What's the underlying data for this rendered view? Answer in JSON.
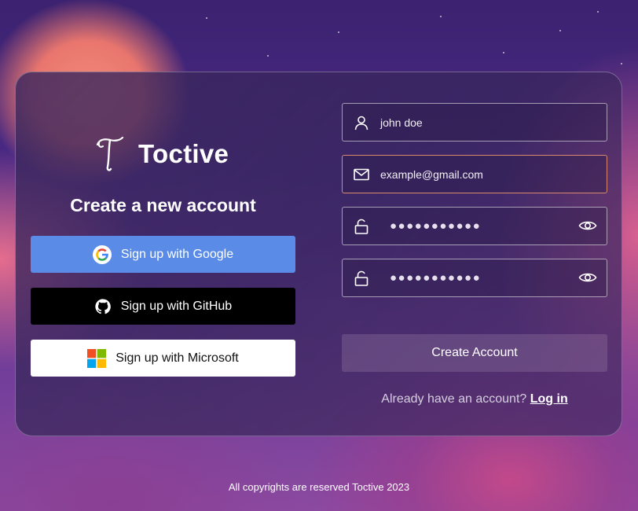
{
  "brand": {
    "name": "Toctive"
  },
  "heading": "Create a new account",
  "sso": {
    "google": "Sign up with Google",
    "github": "Sign up with GitHub",
    "microsoft": "Sign up with Microsoft"
  },
  "form": {
    "name_value": "john doe",
    "email_value": "example@gmail.com",
    "password_mask": "●●●●●●●●●●●",
    "confirm_mask": "●●●●●●●●●●●",
    "submit_label": "Create Account"
  },
  "login": {
    "prompt": "Already have an account?",
    "link": "Log in"
  },
  "footer": "All copyrights are reserved Toctive 2023",
  "colors": {
    "google_button": "#5a8be6",
    "github_button": "#000000",
    "microsoft_button": "#ffffff",
    "email_focus_border": "#d98a6e"
  }
}
